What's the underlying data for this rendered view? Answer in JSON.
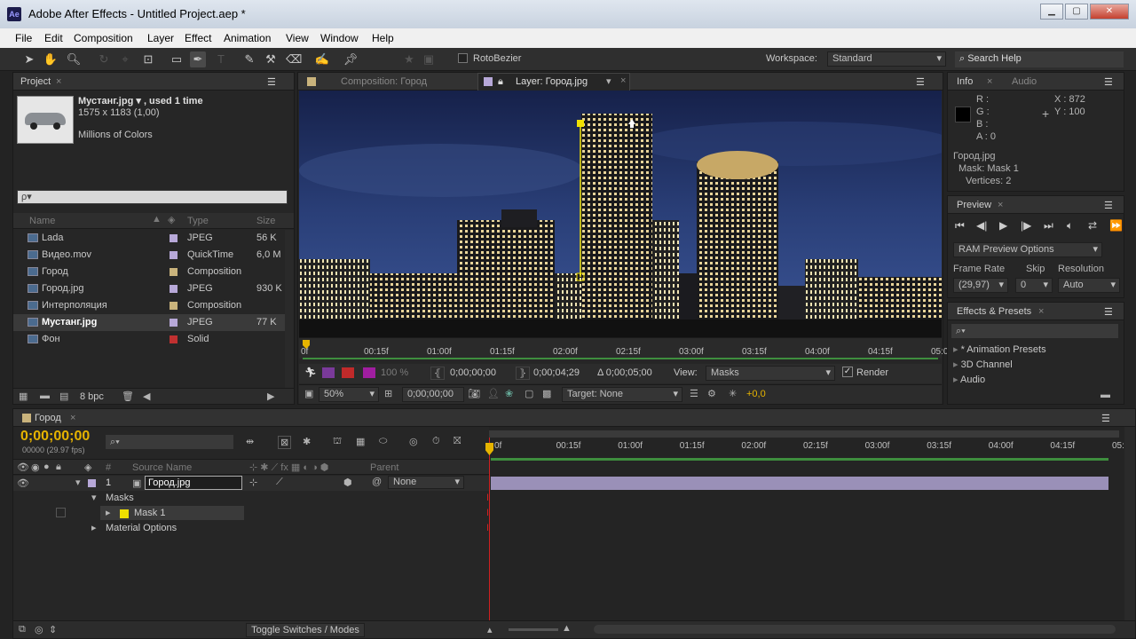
{
  "app": {
    "title": "Adobe After Effects - Untitled Project.aep *",
    "icon": "ae-icon"
  },
  "menu": [
    "File",
    "Edit",
    "Composition",
    "Layer",
    "Effect",
    "Animation",
    "View",
    "Window",
    "Help"
  ],
  "toolbar": {
    "rotobezier": "RotoBezier",
    "workspace_label": "Workspace:",
    "workspace_value": "Standard",
    "search_help": "Search Help"
  },
  "project": {
    "tab": "Project",
    "preview_name": "Мустанг.jpg ▾ , used 1 time",
    "preview_dims": "1575 x 1183 (1,00)",
    "preview_colors": "Millions of Colors",
    "search_placeholder": "ρ▾",
    "columns": {
      "name": "Name",
      "type": "Type",
      "size": "Size"
    },
    "items": [
      {
        "name": "Lada",
        "type": "JPEG",
        "size": "56 K",
        "color": "#b7a8d8"
      },
      {
        "name": "Видео.mov",
        "type": "QuickTime",
        "size": "6,0 M",
        "color": "#b7a8d8"
      },
      {
        "name": "Город",
        "type": "Composition",
        "size": "",
        "color": "#c9b37c"
      },
      {
        "name": "Город.jpg",
        "type": "JPEG",
        "size": "930 K",
        "color": "#b7a8d8"
      },
      {
        "name": "Интерполяция",
        "type": "Composition",
        "size": "",
        "color": "#c9b37c"
      },
      {
        "name": "Мустанг.jpg",
        "type": "JPEG",
        "size": "77 K",
        "color": "#b7a8d8"
      },
      {
        "name": "Фон",
        "type": "Solid",
        "size": "",
        "color": "#c03030"
      }
    ],
    "bpc": "8 bpc"
  },
  "viewer": {
    "tab_comp": "Composition: Город",
    "tab_layer": "Layer: Город.jpg",
    "ruler": [
      "0f",
      "00:15f",
      "01:00f",
      "01:15f",
      "02:00f",
      "02:15f",
      "03:00f",
      "03:15f",
      "04:00f",
      "04:15f",
      "05:0"
    ],
    "opacity": "100 %",
    "in_time": "0;00;00;00",
    "out_time": "0;00;04;29",
    "duration": "Δ 0;00;05;00",
    "view_label": "View:",
    "view_value": "Masks",
    "render_label": "Render",
    "zoom": "50%",
    "current_time": "0;00;00;00",
    "target": "Target: None",
    "exposure": "+0,0"
  },
  "info": {
    "tab": "Info",
    "tab2": "Audio",
    "r": "R :",
    "g": "G :",
    "b": "B :",
    "a": "A : 0",
    "x": "X : 872",
    "y": "Y : 100",
    "layer": "Город.jpg",
    "mask": "Mask: Mask 1",
    "vertices": "Vertices: 2"
  },
  "preview": {
    "tab": "Preview",
    "ram": "RAM Preview Options",
    "frame_rate_label": "Frame Rate",
    "skip_label": "Skip",
    "resolution_label": "Resolution",
    "frame_rate": "(29,97)",
    "skip": "0",
    "resolution": "Auto"
  },
  "effects": {
    "tab": "Effects & Presets",
    "items": [
      "* Animation Presets",
      "3D Channel",
      "Audio"
    ]
  },
  "timeline": {
    "tab": "Город",
    "timecode": "0;00;00;00",
    "fps": "00000 (29.97 fps)",
    "ruler": [
      "0f",
      "00:15f",
      "01:00f",
      "01:15f",
      "02:00f",
      "02:15f",
      "03:00f",
      "03:15f",
      "04:00f",
      "04:15f",
      "05:0"
    ],
    "col_source": "Source Name",
    "col_parent": "Parent",
    "layer_num": "1",
    "layer_name": "Город.jpg",
    "parent_value": "None",
    "masks_label": "Masks",
    "mask1": "Mask 1",
    "material": "Material Options",
    "toggle": "Toggle Switches / Modes"
  }
}
